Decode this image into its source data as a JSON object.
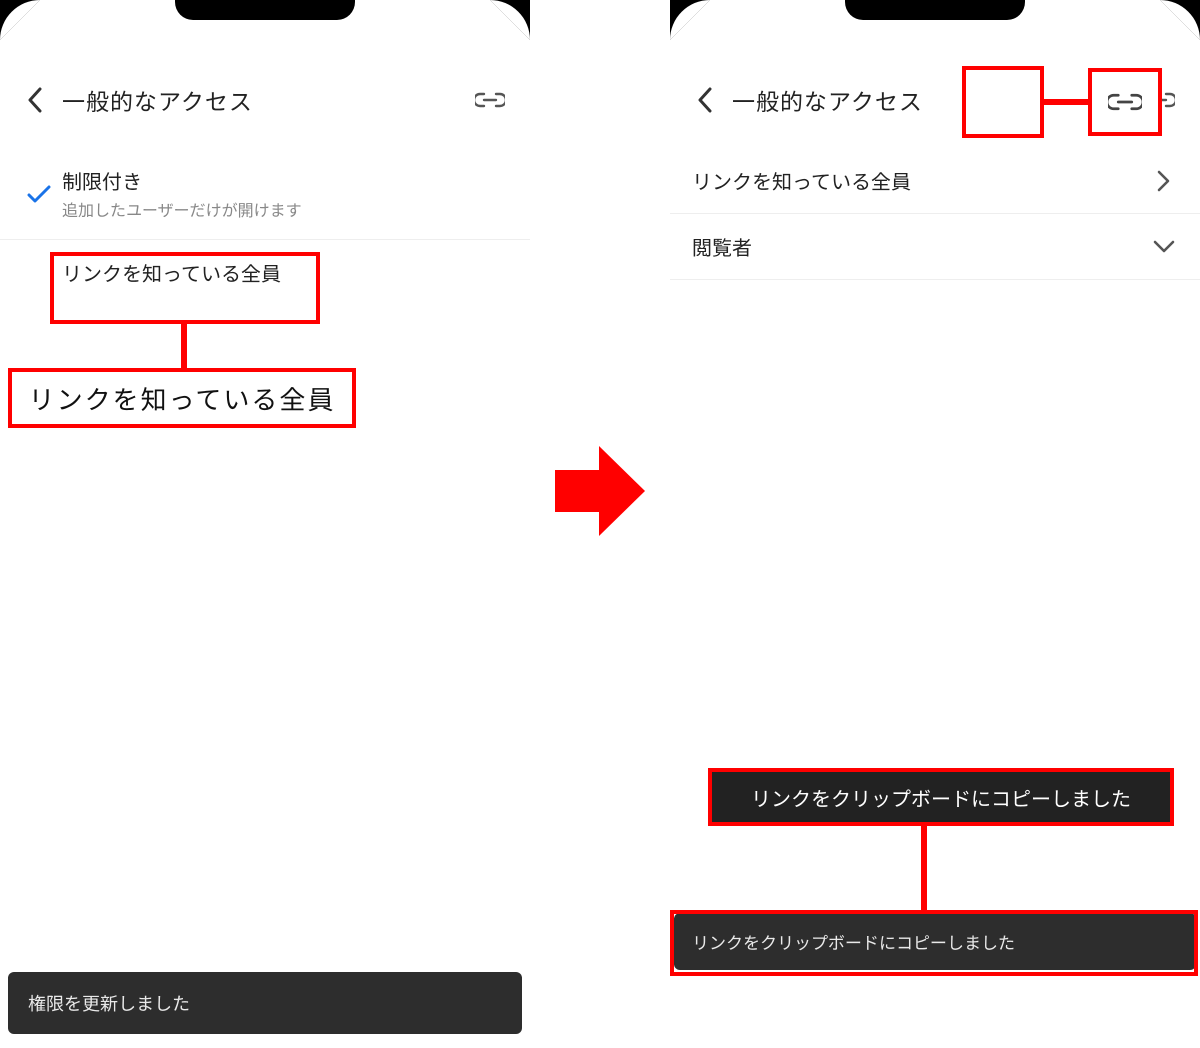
{
  "left": {
    "header_title": "一般的なアクセス",
    "option_restricted": {
      "title": "制限付き",
      "subtitle": "追加したユーザーだけが開けます"
    },
    "option_anyone": "リンクを知っている全員",
    "callout_anyone": "リンクを知っている全員",
    "toast": "権限を更新しました"
  },
  "right": {
    "header_title": "一般的なアクセス",
    "row_anyone": "リンクを知っている全員",
    "row_viewer": "閲覧者",
    "callout_toast": "リンクをクリップボードにコピーしました",
    "toast": "リンクをクリップボードにコピーしました"
  },
  "colors": {
    "annotation": "#ff0000",
    "check": "#1a73e8",
    "toast_bg": "#2d2d2d"
  }
}
